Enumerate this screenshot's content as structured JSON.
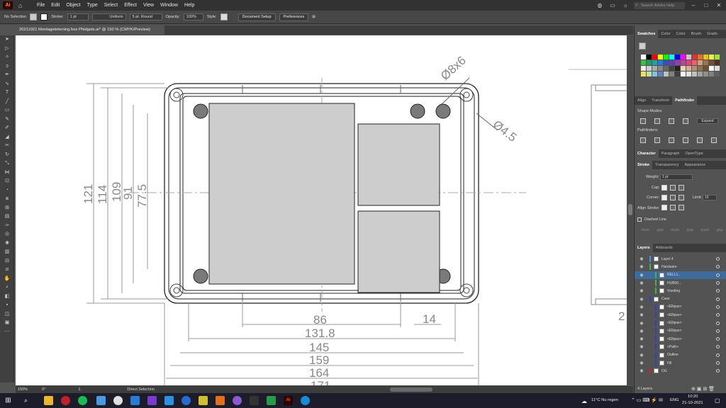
{
  "app": {
    "logo": "Ai",
    "menu": [
      "File",
      "Edit",
      "Object",
      "Type",
      "Select",
      "Effect",
      "View",
      "Window",
      "Help"
    ],
    "search_placeholder": "Search Adobe Help"
  },
  "control_bar": {
    "selection": "No Selection",
    "stroke_label": "Stroke:",
    "stroke_value": "1 pt",
    "uniform": "Uniform",
    "brush": "5 pt. Round",
    "opacity_label": "Opacity:",
    "opacity_value": "100%",
    "style_label": "Style:",
    "doc_setup": "Document Setup",
    "preferences": "Preferences"
  },
  "document_tab": "20211021 Montagetekening box Phidgets.ai* @ 150 % (CMYK/Preview)",
  "drawing": {
    "dims_vertical": [
      "121",
      "114",
      "109",
      "91",
      "77.5"
    ],
    "dims_horizontal": [
      "86",
      "131.8",
      "145",
      "159",
      "164",
      "171"
    ],
    "dim_right": "14",
    "hole_large": "Ø8x6",
    "hole_small": "Ø4.5",
    "partial_right_label": "2"
  },
  "status_bar": {
    "zoom": "150%",
    "angle": "0°",
    "artboard": "1",
    "tool": "Direct Selection"
  },
  "panels": {
    "swatch_tabs": [
      "Swatches",
      "Color",
      "Color",
      "Brush",
      "Grads"
    ],
    "align_tabs": [
      "Align",
      "Transform",
      "Pathfinder"
    ],
    "shape_modes": "Shape Modes:",
    "expand": "Expand",
    "pathfinders": "Pathfinders:",
    "char_tabs": [
      "Character",
      "Paragraph",
      "OpenType"
    ],
    "stroke_tabs": [
      "Stroke",
      "Transparency",
      "Appearance"
    ],
    "weight_label": "Weight:",
    "weight_value": "1 pt",
    "cap_label": "Cap:",
    "corner_label": "Corner:",
    "limit_label": "Limit:",
    "limit_value": "10",
    "align_stroke": "Align Stroke:",
    "dashed_line": "Dashed Line",
    "dash_labels": [
      "dash",
      "gap",
      "dash",
      "gap",
      "dash",
      "gap"
    ],
    "layers_tabs": [
      "Layers",
      "Artboards"
    ],
    "layers_count": "4 Layers",
    "layers": [
      {
        "name": "Layer 4",
        "color": "#4f8cf0",
        "indent": 0,
        "selected": false
      },
      {
        "name": "Hardware",
        "color": "#3cb44b",
        "indent": 0,
        "selected": false
      },
      {
        "name": "RELL1...",
        "color": "#3cb44b",
        "indent": 2,
        "selected": true
      },
      {
        "name": "HUB00...",
        "color": "#3cb44b",
        "indent": 2,
        "selected": false
      },
      {
        "name": "Voeding",
        "color": "#3cb44b",
        "indent": 2,
        "selected": false
      },
      {
        "name": "Case",
        "color": "#3040c0",
        "indent": 0,
        "selected": false
      },
      {
        "name": "<Ellipse>",
        "color": "#3040c0",
        "indent": 2,
        "selected": false
      },
      {
        "name": "<Ellipse>",
        "color": "#3040c0",
        "indent": 2,
        "selected": false
      },
      {
        "name": "<Ellipse>",
        "color": "#3040c0",
        "indent": 2,
        "selected": false
      },
      {
        "name": "<Ellipse>",
        "color": "#3040c0",
        "indent": 2,
        "selected": false
      },
      {
        "name": "<Ellipse>",
        "color": "#3040c0",
        "indent": 2,
        "selected": false
      },
      {
        "name": "<Path>",
        "color": "#3040c0",
        "indent": 2,
        "selected": false
      },
      {
        "name": "Outline",
        "color": "#3040c0",
        "indent": 2,
        "selected": false
      },
      {
        "name": "Fill",
        "color": "#3040c0",
        "indent": 2,
        "selected": false
      },
      {
        "name": "OG",
        "color": "#d02020",
        "indent": 0,
        "selected": false
      }
    ]
  },
  "taskbar": {
    "weather": "11°C  Nu regen",
    "lang": "ENG",
    "time": "10:20",
    "date": "21-10-2021"
  }
}
